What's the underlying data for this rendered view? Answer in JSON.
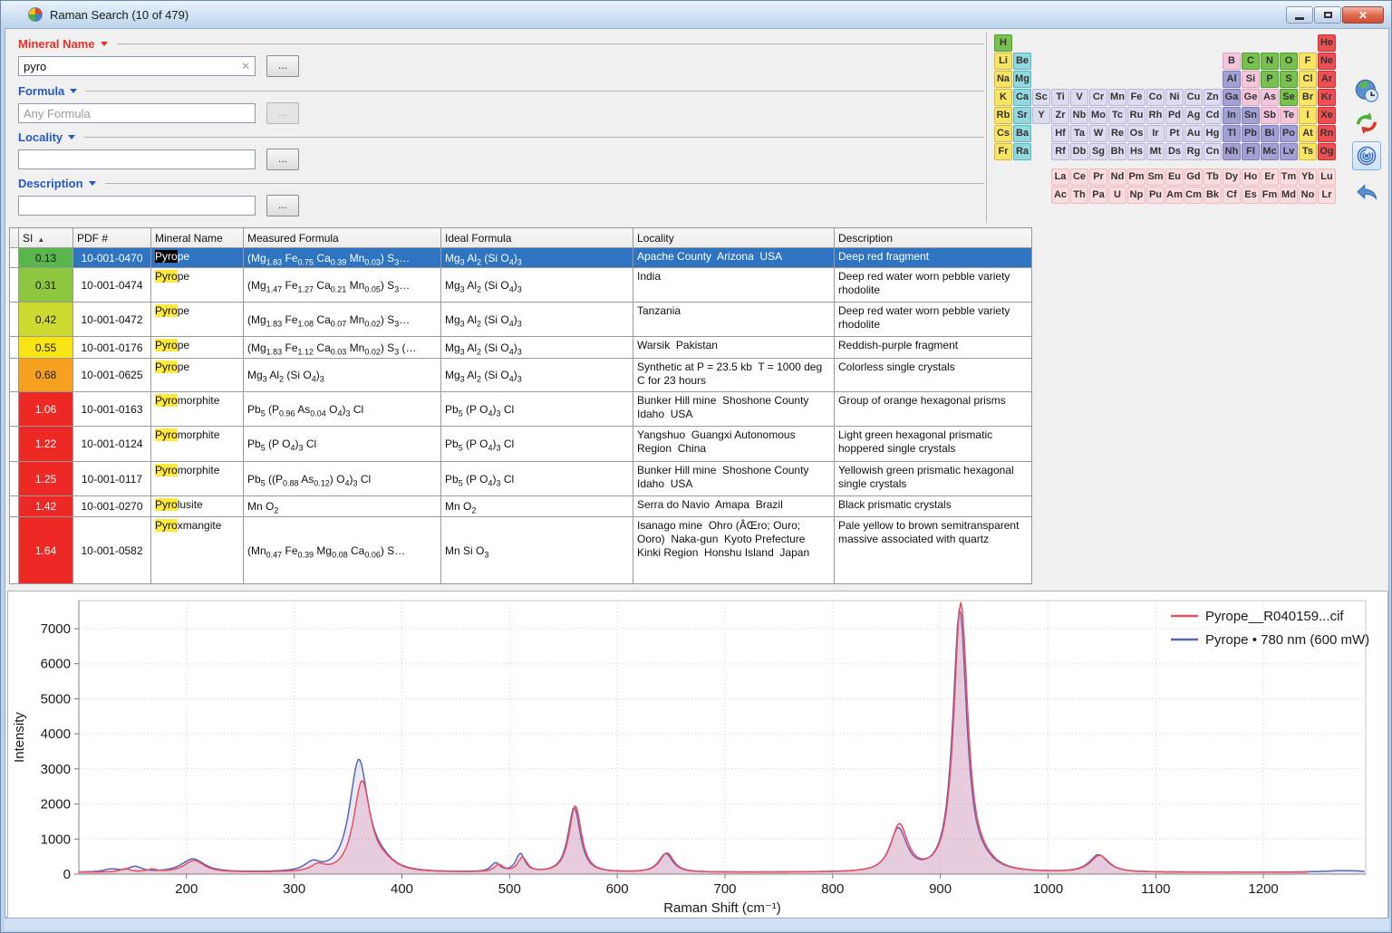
{
  "window": {
    "title": "Raman Search (10 of 479)",
    "buttons": [
      "minimize",
      "maximize",
      "close"
    ],
    "close_glyph": "✕"
  },
  "search": {
    "browse_label": "...",
    "fields": [
      {
        "label": "Mineral Name",
        "label_color": "#e8312a",
        "value": "pyro",
        "clear_glyph": "✕",
        "browse_enabled": true
      },
      {
        "label": "Formula",
        "label_color": "#2558c8",
        "placeholder": "Any Formula",
        "browse_enabled": false
      },
      {
        "label": "Locality",
        "label_color": "#2558c8",
        "value": "",
        "browse_enabled": true
      },
      {
        "label": "Description",
        "label_color": "#2558c8",
        "value": "",
        "browse_enabled": true
      }
    ]
  },
  "periodic_table": {
    "colors": {
      "g": [
        "#79c14e",
        "#4f9e2f"
      ],
      "y": [
        "#f9e464",
        "#d2bb3a"
      ],
      "c": [
        "#92d8de",
        "#5ab6bf"
      ],
      "l": [
        "#dddbf0",
        "#b7b5da"
      ],
      "pu": [
        "#a3a0d5",
        "#7f7cbd"
      ],
      "pk": [
        "#f4c6db",
        "#dc9fc0"
      ],
      "lp": [
        "#fadcdc",
        "#efb7b7"
      ],
      "r": [
        "#ef4f53",
        "#cb2d34"
      ]
    },
    "rows": [
      [
        [
          "H",
          "g",
          1
        ],
        [
          "He",
          "r",
          18
        ]
      ],
      [
        [
          "Li",
          "y",
          1
        ],
        [
          "Be",
          "c",
          2
        ],
        [
          "B",
          "pk",
          13
        ],
        [
          "C",
          "g",
          14
        ],
        [
          "N",
          "g",
          15
        ],
        [
          "O",
          "g",
          16
        ],
        [
          "F",
          "y",
          17
        ],
        [
          "Ne",
          "r",
          18
        ]
      ],
      [
        [
          "Na",
          "y",
          1
        ],
        [
          "Mg",
          "c",
          2
        ],
        [
          "Al",
          "pu",
          13
        ],
        [
          "Si",
          "pk",
          14
        ],
        [
          "P",
          "g",
          15
        ],
        [
          "S",
          "g",
          16
        ],
        [
          "Cl",
          "y",
          17
        ],
        [
          "Ar",
          "r",
          18
        ]
      ],
      [
        [
          "K",
          "y",
          1
        ],
        [
          "Ca",
          "c",
          2
        ],
        [
          "Sc",
          "l",
          3
        ],
        [
          "Ti",
          "l",
          4
        ],
        [
          "V",
          "l",
          5
        ],
        [
          "Cr",
          "l",
          6
        ],
        [
          "Mn",
          "l",
          7
        ],
        [
          "Fe",
          "l",
          8
        ],
        [
          "Co",
          "l",
          9
        ],
        [
          "Ni",
          "l",
          10
        ],
        [
          "Cu",
          "l",
          11
        ],
        [
          "Zn",
          "l",
          12
        ],
        [
          "Ga",
          "pu",
          13
        ],
        [
          "Ge",
          "pk",
          14
        ],
        [
          "As",
          "pk",
          15
        ],
        [
          "Se",
          "g",
          16
        ],
        [
          "Br",
          "y",
          17
        ],
        [
          "Kr",
          "r",
          18
        ]
      ],
      [
        [
          "Rb",
          "y",
          1
        ],
        [
          "Sr",
          "c",
          2
        ],
        [
          "Y",
          "l",
          3
        ],
        [
          "Zr",
          "l",
          4
        ],
        [
          "Nb",
          "l",
          5
        ],
        [
          "Mo",
          "l",
          6
        ],
        [
          "Tc",
          "l",
          7
        ],
        [
          "Ru",
          "l",
          8
        ],
        [
          "Rh",
          "l",
          9
        ],
        [
          "Pd",
          "l",
          10
        ],
        [
          "Ag",
          "l",
          11
        ],
        [
          "Cd",
          "l",
          12
        ],
        [
          "In",
          "pu",
          13
        ],
        [
          "Sn",
          "pu",
          14
        ],
        [
          "Sb",
          "pk",
          15
        ],
        [
          "Te",
          "pk",
          16
        ],
        [
          "I",
          "y",
          17
        ],
        [
          "Xe",
          "r",
          18
        ]
      ],
      [
        [
          "Cs",
          "y",
          1
        ],
        [
          "Ba",
          "c",
          2
        ],
        [
          "Hf",
          "l",
          4
        ],
        [
          "Ta",
          "l",
          5
        ],
        [
          "W",
          "l",
          6
        ],
        [
          "Re",
          "l",
          7
        ],
        [
          "Os",
          "l",
          8
        ],
        [
          "Ir",
          "l",
          9
        ],
        [
          "Pt",
          "l",
          10
        ],
        [
          "Au",
          "l",
          11
        ],
        [
          "Hg",
          "l",
          12
        ],
        [
          "Tl",
          "pu",
          13
        ],
        [
          "Pb",
          "pu",
          14
        ],
        [
          "Bi",
          "pu",
          15
        ],
        [
          "Po",
          "pu",
          16
        ],
        [
          "At",
          "y",
          17
        ],
        [
          "Rn",
          "r",
          18
        ]
      ],
      [
        [
          "Fr",
          "y",
          1
        ],
        [
          "Ra",
          "c",
          2
        ],
        [
          "Rf",
          "l",
          4
        ],
        [
          "Db",
          "l",
          5
        ],
        [
          "Sg",
          "l",
          6
        ],
        [
          "Bh",
          "l",
          7
        ],
        [
          "Hs",
          "l",
          8
        ],
        [
          "Mt",
          "l",
          9
        ],
        [
          "Ds",
          "l",
          10
        ],
        [
          "Rg",
          "l",
          11
        ],
        [
          "Cn",
          "l",
          12
        ],
        [
          "Nh",
          "pu",
          13
        ],
        [
          "Fl",
          "pu",
          14
        ],
        [
          "Mc",
          "pu",
          15
        ],
        [
          "Lv",
          "pu",
          16
        ],
        [
          "Ts",
          "y",
          17
        ],
        [
          "Og",
          "r",
          18
        ]
      ],
      [
        [
          "La",
          "lp",
          4
        ],
        [
          "Ce",
          "lp",
          5
        ],
        [
          "Pr",
          "lp",
          6
        ],
        [
          "Nd",
          "lp",
          7
        ],
        [
          "Pm",
          "lp",
          8
        ],
        [
          "Sm",
          "lp",
          9
        ],
        [
          "Eu",
          "lp",
          10
        ],
        [
          "Gd",
          "lp",
          11
        ],
        [
          "Tb",
          "lp",
          12
        ],
        [
          "Dy",
          "lp",
          13
        ],
        [
          "Ho",
          "lp",
          14
        ],
        [
          "Er",
          "lp",
          15
        ],
        [
          "Tm",
          "lp",
          16
        ],
        [
          "Yb",
          "lp",
          17
        ],
        [
          "Lu",
          "lp",
          18
        ]
      ],
      [
        [
          "Ac",
          "lp",
          4
        ],
        [
          "Th",
          "lp",
          5
        ],
        [
          "Pa",
          "lp",
          6
        ],
        [
          "U",
          "lp",
          7
        ],
        [
          "Np",
          "lp",
          8
        ],
        [
          "Pu",
          "lp",
          9
        ],
        [
          "Am",
          "lp",
          10
        ],
        [
          "Cm",
          "lp",
          11
        ],
        [
          "Bk",
          "lp",
          12
        ],
        [
          "Cf",
          "lp",
          13
        ],
        [
          "Es",
          "lp",
          14
        ],
        [
          "Fm",
          "lp",
          15
        ],
        [
          "Md",
          "lp",
          16
        ],
        [
          "No",
          "lp",
          17
        ],
        [
          "Lr",
          "lp",
          18
        ]
      ]
    ]
  },
  "side_tools": [
    {
      "name": "globe-history",
      "selected": false
    },
    {
      "name": "refresh",
      "selected": false
    },
    {
      "name": "fingerprint-search",
      "selected": true
    },
    {
      "name": "undo",
      "selected": false
    }
  ],
  "table": {
    "sort_icon": "▲",
    "headers": [
      "SI",
      "PDF #",
      "Mineral Name",
      "Measured Formula",
      "Ideal Formula",
      "Locality",
      "Description"
    ],
    "rows": [
      {
        "h": 22,
        "selected": true,
        "si": "0.13",
        "si_color": "#58b64b",
        "si_text": "#1b1b1b",
        "pdf": "10-001-0470",
        "mineral_prefix": "Pyro",
        "mineral_rest": "pe",
        "measured": "(Mg~1.83~ Fe~0.75~ Ca~0.39~ Mn~0.03~) S~3~…",
        "ideal": "Mg~3~ Al~2~ (Si O~4~)~3~",
        "locality": "Apache County  Arizona  USA",
        "description": "Deep red fragment"
      },
      {
        "h": 38,
        "selected": false,
        "si": "0.31",
        "si_color": "#8cc63f",
        "si_text": "#1b1b1b",
        "pdf": "10-001-0474",
        "mineral_prefix": "Pyro",
        "mineral_rest": "pe",
        "measured": "(Mg~1.47~ Fe~1.27~ Ca~0.21~ Mn~0.05~) S~3~…",
        "ideal": "Mg~3~ Al~2~ (Si O~4~)~3~",
        "locality": "India",
        "description": "Deep red water worn pebble variety rhodolite"
      },
      {
        "h": 38,
        "selected": false,
        "si": "0.42",
        "si_color": "#ccd92f",
        "si_text": "#1b1b1b",
        "pdf": "10-001-0472",
        "mineral_prefix": "Pyro",
        "mineral_rest": "pe",
        "measured": "(Mg~1.83~ Fe~1.08~ Ca~0.07~ Mn~0.02~) S~3~…",
        "ideal": "Mg~3~ Al~2~ (Si O~4~)~3~",
        "locality": "Tanzania",
        "description": "Deep red water worn pebble variety rhodolite"
      },
      {
        "h": 24,
        "selected": false,
        "si": "0.55",
        "si_color": "#f8e414",
        "si_text": "#1b1b1b",
        "pdf": "10-001-0176",
        "mineral_prefix": "Pyro",
        "mineral_rest": "pe",
        "measured": "(Mg~1.83~ Fe~1.12~ Ca~0.03~ Mn~0.02~) S~3~ (…",
        "ideal": "Mg~3~ Al~2~ (Si O~4~)~3~",
        "locality": "Warsik  Pakistan",
        "description": "Reddish-purple fragment"
      },
      {
        "h": 37,
        "selected": false,
        "si": "0.68",
        "si_color": "#f6a01f",
        "si_text": "#1b1b1b",
        "pdf": "10-001-0625",
        "mineral_prefix": "Pyro",
        "mineral_rest": "pe",
        "measured": "Mg~3~ Al~2~ (Si O~4~)~3~",
        "ideal": "Mg~3~ Al~2~ (Si O~4~)~3~",
        "locality": "Synthetic at P = 23.5 kb  T = 1000 deg C for 23 hours",
        "description": "Colorless single crystals"
      },
      {
        "h": 38,
        "selected": false,
        "si": "1.06",
        "si_color": "#ee2824",
        "si_text": "#ffffff",
        "pdf": "10-001-0163",
        "mineral_prefix": "Pyro",
        "mineral_rest": "morphite",
        "measured": "Pb~5~ (P~0.96~ As~0.04~ O~4~)~3~ Cl",
        "ideal": "Pb~5~ (P O~4~)~3~ Cl",
        "locality": "Bunker Hill mine  Shoshone County  Idaho  USA",
        "description": "Group of orange hexagonal prisms"
      },
      {
        "h": 39,
        "selected": false,
        "si": "1.22",
        "si_color": "#ee2824",
        "si_text": "#ffffff",
        "pdf": "10-001-0124",
        "mineral_prefix": "Pyro",
        "mineral_rest": "morphite",
        "measured": "Pb~5~ (P O~4~)~3~ Cl",
        "ideal": "Pb~5~ (P O~4~)~3~ Cl",
        "locality": "Yangshuo  Guangxi Autonomous Region  China",
        "description": "Light green hexagonal prismatic hoppered single crystals"
      },
      {
        "h": 38,
        "selected": false,
        "si": "1.25",
        "si_color": "#ee2824",
        "si_text": "#ffffff",
        "pdf": "10-001-0117",
        "mineral_prefix": "Pyro",
        "mineral_rest": "morphite",
        "measured": "Pb~5~ ((P~0.88~ As~0.12~) O~4~)~3~ Cl",
        "ideal": "Pb~5~ (P O~4~)~3~ Cl",
        "locality": "Bunker Hill mine  Shoshone County  Idaho  USA",
        "description": "Yellowish green prismatic hexagonal single crystals"
      },
      {
        "h": 23,
        "selected": false,
        "si": "1.42",
        "si_color": "#ee2824",
        "si_text": "#ffffff",
        "pdf": "10-001-0270",
        "mineral_prefix": "Pyro",
        "mineral_rest": "lusite",
        "measured": "Mn O~2~",
        "ideal": "Mn O~2~",
        "locality": "Serra do Navio  Amapa  Brazil",
        "description": "Black prismatic crystals"
      },
      {
        "h": 74,
        "selected": false,
        "si": "1.64",
        "si_color": "#ee2824",
        "si_text": "#ffffff",
        "pdf": "10-001-0582",
        "mineral_prefix": "Pyro",
        "mineral_rest": "xmangite",
        "measured": "(Mn~0.47~ Fe~0.39~ Mg~0.08~ Ca~0.06~) S…",
        "ideal": "Mn Si O~3~",
        "locality": "Isanago mine  Ohro (ÂŒro; Ouro; Ooro)  Naka-gun  Kyoto Prefecture  Kinki Region  Honshu Island  Japan",
        "description": "Pale yellow to brown semitransparent massive associated with quartz"
      }
    ]
  },
  "chart_data": {
    "type": "line",
    "title": "",
    "xlabel": "Raman Shift (cm⁻¹)",
    "ylabel": "Intensity",
    "xlim": [
      100,
      1295
    ],
    "ylim": [
      0,
      7800
    ],
    "x_ticks": [
      200,
      300,
      400,
      500,
      600,
      700,
      800,
      900,
      1000,
      1100,
      1200
    ],
    "y_ticks": [
      0,
      1000,
      2000,
      3000,
      4000,
      5000,
      6000,
      7000
    ],
    "grid": "dotted",
    "legend_position": "top-right",
    "series": [
      {
        "name": "Pyrope__R040159...cif",
        "color": "#e85060",
        "fill": "rgba(225,70,120,0.18)",
        "baseline": 55,
        "domain": [
          100,
          1242
        ],
        "peaks": [
          [
            143,
            90,
            7
          ],
          [
            168,
            70,
            7
          ],
          [
            207,
            330,
            13
          ],
          [
            322,
            180,
            9
          ],
          [
            363,
            2540,
            11
          ],
          [
            383,
            230,
            16
          ],
          [
            490,
            200,
            6
          ],
          [
            512,
            410,
            6
          ],
          [
            561,
            1890,
            8
          ],
          [
            646,
            545,
            9
          ],
          [
            862,
            1320,
            11
          ],
          [
            919,
            7590,
            9
          ],
          [
            938,
            250,
            18
          ],
          [
            1048,
            470,
            12
          ]
        ]
      },
      {
        "name": "Pyrope • 780 nm (600 mW)",
        "color": "#5a64b8",
        "fill": "rgba(100,110,190,0.15)",
        "baseline": 55,
        "domain": [
          100,
          1295
        ],
        "peaks": [
          [
            130,
            80,
            9
          ],
          [
            152,
            150,
            9
          ],
          [
            206,
            375,
            15
          ],
          [
            317,
            235,
            10
          ],
          [
            360,
            3140,
            12
          ],
          [
            380,
            260,
            16
          ],
          [
            487,
            245,
            6
          ],
          [
            510,
            510,
            6
          ],
          [
            560,
            1840,
            8
          ],
          [
            645,
            525,
            9
          ],
          [
            861,
            1210,
            11
          ],
          [
            918,
            7390,
            9
          ],
          [
            937,
            240,
            18
          ],
          [
            1047,
            490,
            12
          ],
          [
            1275,
            45,
            25
          ]
        ]
      }
    ]
  }
}
